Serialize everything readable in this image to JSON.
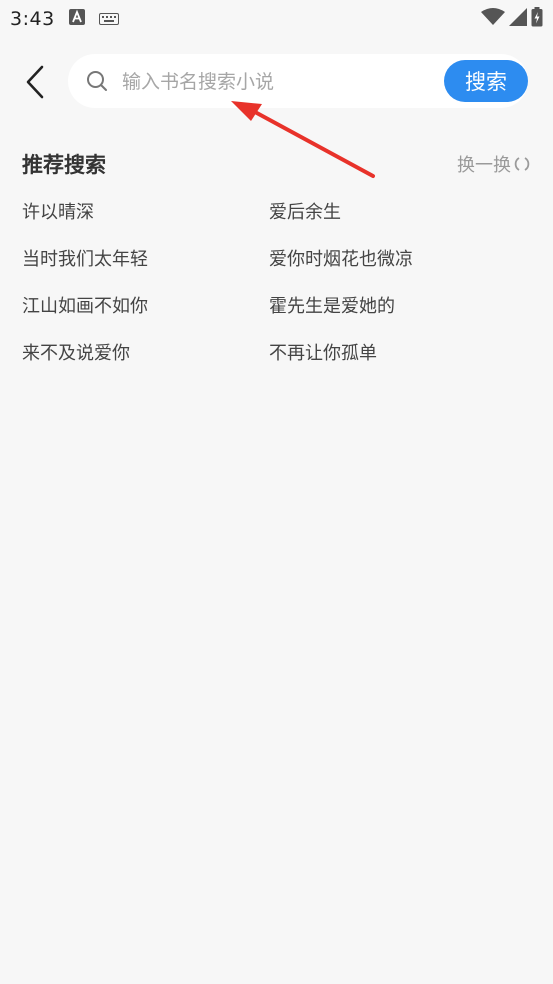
{
  "status_bar": {
    "time": "3:43"
  },
  "search": {
    "placeholder": "输入书名搜索小说",
    "value": "",
    "button_label": "搜索"
  },
  "recommend": {
    "title": "推荐搜索",
    "refresh_label": "换一换",
    "items": [
      "许以晴深",
      "爱后余生",
      "当时我们太年轻",
      "爱你时烟花也微凉",
      "江山如画不如你",
      "霍先生是爱她的",
      "来不及说爱你",
      "不再让你孤单"
    ]
  },
  "colors": {
    "accent": "#2d8cf0",
    "arrow": "#e8322a",
    "background": "#f7f7f7"
  },
  "icons": [
    "back-arrow-icon",
    "search-icon",
    "refresh-icon",
    "wifi-icon",
    "signal-icon",
    "battery-icon",
    "keyboard-icon",
    "a-notification-icon"
  ]
}
